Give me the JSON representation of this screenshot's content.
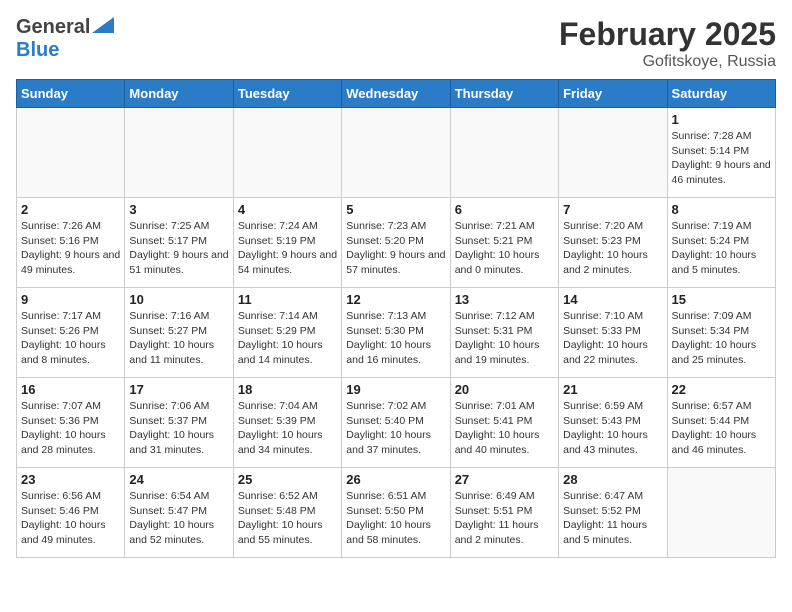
{
  "header": {
    "logo_general": "General",
    "logo_blue": "Blue",
    "month_year": "February 2025",
    "location": "Gofitskoye, Russia"
  },
  "weekdays": [
    "Sunday",
    "Monday",
    "Tuesday",
    "Wednesday",
    "Thursday",
    "Friday",
    "Saturday"
  ],
  "weeks": [
    [
      {
        "day": "",
        "info": ""
      },
      {
        "day": "",
        "info": ""
      },
      {
        "day": "",
        "info": ""
      },
      {
        "day": "",
        "info": ""
      },
      {
        "day": "",
        "info": ""
      },
      {
        "day": "",
        "info": ""
      },
      {
        "day": "1",
        "info": "Sunrise: 7:28 AM\nSunset: 5:14 PM\nDaylight: 9 hours and 46 minutes."
      }
    ],
    [
      {
        "day": "2",
        "info": "Sunrise: 7:26 AM\nSunset: 5:16 PM\nDaylight: 9 hours and 49 minutes."
      },
      {
        "day": "3",
        "info": "Sunrise: 7:25 AM\nSunset: 5:17 PM\nDaylight: 9 hours and 51 minutes."
      },
      {
        "day": "4",
        "info": "Sunrise: 7:24 AM\nSunset: 5:19 PM\nDaylight: 9 hours and 54 minutes."
      },
      {
        "day": "5",
        "info": "Sunrise: 7:23 AM\nSunset: 5:20 PM\nDaylight: 9 hours and 57 minutes."
      },
      {
        "day": "6",
        "info": "Sunrise: 7:21 AM\nSunset: 5:21 PM\nDaylight: 10 hours and 0 minutes."
      },
      {
        "day": "7",
        "info": "Sunrise: 7:20 AM\nSunset: 5:23 PM\nDaylight: 10 hours and 2 minutes."
      },
      {
        "day": "8",
        "info": "Sunrise: 7:19 AM\nSunset: 5:24 PM\nDaylight: 10 hours and 5 minutes."
      }
    ],
    [
      {
        "day": "9",
        "info": "Sunrise: 7:17 AM\nSunset: 5:26 PM\nDaylight: 10 hours and 8 minutes."
      },
      {
        "day": "10",
        "info": "Sunrise: 7:16 AM\nSunset: 5:27 PM\nDaylight: 10 hours and 11 minutes."
      },
      {
        "day": "11",
        "info": "Sunrise: 7:14 AM\nSunset: 5:29 PM\nDaylight: 10 hours and 14 minutes."
      },
      {
        "day": "12",
        "info": "Sunrise: 7:13 AM\nSunset: 5:30 PM\nDaylight: 10 hours and 16 minutes."
      },
      {
        "day": "13",
        "info": "Sunrise: 7:12 AM\nSunset: 5:31 PM\nDaylight: 10 hours and 19 minutes."
      },
      {
        "day": "14",
        "info": "Sunrise: 7:10 AM\nSunset: 5:33 PM\nDaylight: 10 hours and 22 minutes."
      },
      {
        "day": "15",
        "info": "Sunrise: 7:09 AM\nSunset: 5:34 PM\nDaylight: 10 hours and 25 minutes."
      }
    ],
    [
      {
        "day": "16",
        "info": "Sunrise: 7:07 AM\nSunset: 5:36 PM\nDaylight: 10 hours and 28 minutes."
      },
      {
        "day": "17",
        "info": "Sunrise: 7:06 AM\nSunset: 5:37 PM\nDaylight: 10 hours and 31 minutes."
      },
      {
        "day": "18",
        "info": "Sunrise: 7:04 AM\nSunset: 5:39 PM\nDaylight: 10 hours and 34 minutes."
      },
      {
        "day": "19",
        "info": "Sunrise: 7:02 AM\nSunset: 5:40 PM\nDaylight: 10 hours and 37 minutes."
      },
      {
        "day": "20",
        "info": "Sunrise: 7:01 AM\nSunset: 5:41 PM\nDaylight: 10 hours and 40 minutes."
      },
      {
        "day": "21",
        "info": "Sunrise: 6:59 AM\nSunset: 5:43 PM\nDaylight: 10 hours and 43 minutes."
      },
      {
        "day": "22",
        "info": "Sunrise: 6:57 AM\nSunset: 5:44 PM\nDaylight: 10 hours and 46 minutes."
      }
    ],
    [
      {
        "day": "23",
        "info": "Sunrise: 6:56 AM\nSunset: 5:46 PM\nDaylight: 10 hours and 49 minutes."
      },
      {
        "day": "24",
        "info": "Sunrise: 6:54 AM\nSunset: 5:47 PM\nDaylight: 10 hours and 52 minutes."
      },
      {
        "day": "25",
        "info": "Sunrise: 6:52 AM\nSunset: 5:48 PM\nDaylight: 10 hours and 55 minutes."
      },
      {
        "day": "26",
        "info": "Sunrise: 6:51 AM\nSunset: 5:50 PM\nDaylight: 10 hours and 58 minutes."
      },
      {
        "day": "27",
        "info": "Sunrise: 6:49 AM\nSunset: 5:51 PM\nDaylight: 11 hours and 2 minutes."
      },
      {
        "day": "28",
        "info": "Sunrise: 6:47 AM\nSunset: 5:52 PM\nDaylight: 11 hours and 5 minutes."
      },
      {
        "day": "",
        "info": ""
      }
    ]
  ]
}
